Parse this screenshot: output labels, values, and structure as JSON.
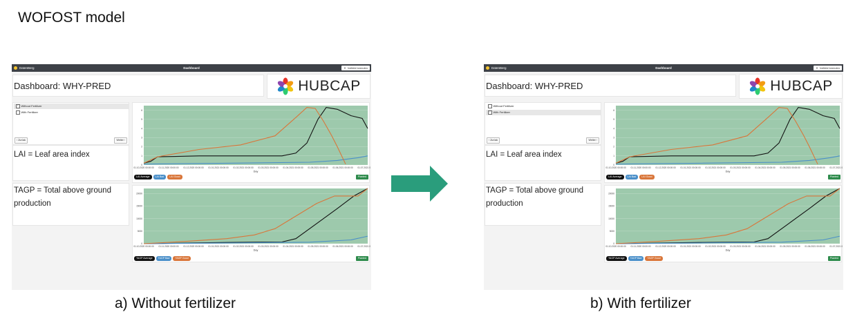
{
  "page": {
    "title": "WOFOST model",
    "arrow_color": "#2a9d7c"
  },
  "dashboard": {
    "brand": "DatenBerg",
    "bar_title": "Dashboard",
    "fullscreen_label": "Vollbild beenden",
    "title": "Dashboard: WHY-PRED",
    "logo_text": "HUBCAP",
    "logo_icon": "hubcap-petal-logo",
    "options": [
      "Without Fertilizer",
      "With Fertilizer"
    ],
    "back_label": "Zurück",
    "next_label": "Weiter",
    "lai_text": "LAI = Leaf area index",
    "tagp_text": "TAGP = Total above ground production",
    "planted_label": "Planted",
    "lai_legend": [
      "LAI Average",
      "LAI Bad",
      "LAI Good"
    ],
    "tagp_legend": [
      "TAGP Average",
      "TAGP Bad",
      "TAGP Good"
    ],
    "xlabel": "Day",
    "plot_bg": "#9dc9ac",
    "series_colors": {
      "average": "#111111",
      "bad": "#4a8fc9",
      "good": "#d9763a"
    }
  },
  "screens": [
    {
      "caption": "a) Without fertilizer",
      "selected_option": 0,
      "chart_data": [
        {
          "type": "line",
          "series": [
            {
              "name": "LAI Average",
              "points": [
                [
                  0,
                  0.2
                ],
                [
                  5,
                  0.4
                ],
                [
                  10,
                  0.9
                ],
                [
                  40,
                  1.0
                ],
                [
                  100,
                  1.0
                ],
                [
                  110,
                  1.3
                ],
                [
                  118,
                  2.4
                ],
                [
                  126,
                  5.0
                ],
                [
                  132,
                  6.3
                ],
                [
                  140,
                  6.1
                ],
                [
                  150,
                  5.4
                ],
                [
                  158,
                  5.1
                ],
                [
                  162,
                  4.0
                ]
              ]
            },
            {
              "name": "LAI Bad",
              "points": [
                [
                  0,
                  0.1
                ],
                [
                  60,
                  0.2
                ],
                [
                  120,
                  0.3
                ],
                [
                  140,
                  0.5
                ],
                [
                  155,
                  0.8
                ],
                [
                  162,
                  1.0
                ]
              ]
            },
            {
              "name": "LAI Good",
              "points": [
                [
                  0,
                  0.2
                ],
                [
                  10,
                  0.9
                ],
                [
                  40,
                  1.7
                ],
                [
                  70,
                  2.2
                ],
                [
                  95,
                  3.2
                ],
                [
                  110,
                  5.2
                ],
                [
                  118,
                  6.3
                ],
                [
                  124,
                  6.2
                ],
                [
                  130,
                  4.8
                ],
                [
                  136,
                  3.2
                ],
                [
                  140,
                  2.0
                ],
                [
                  146,
                  0.1
                ]
              ]
            }
          ],
          "ylim": [
            0,
            6.5
          ],
          "yticks": [
            0,
            1,
            2,
            3,
            4,
            5,
            6
          ],
          "xlim": [
            0,
            162
          ],
          "xticks": [
            "01.10.2020 00:00:00",
            "01.11.2020 00:00:00",
            "01.12.2020 00:00:00",
            "01.01.2021 00:00:00",
            "01.02.2021 00:00:00",
            "01.03.2021 00:00:00",
            "01.04.2021 00:00:00",
            "01.05.2021 00:00:00",
            "01.06.2021 00:00:00",
            "01.07.2021 00:00:00"
          ],
          "xlabel": "Day",
          "grid": true
        },
        {
          "type": "line",
          "series": [
            {
              "name": "TAGP Average",
              "points": [
                [
                  0,
                  0
                ],
                [
                  60,
                  500
                ],
                [
                  100,
                  700
                ],
                [
                  110,
                  2000
                ],
                [
                  125,
                  8000
                ],
                [
                  140,
                  14000
                ],
                [
                  152,
                  19000
                ],
                [
                  162,
                  22000
                ]
              ]
            },
            {
              "name": "TAGP Bad",
              "points": [
                [
                  0,
                  0
                ],
                [
                  60,
                  300
                ],
                [
                  120,
                  600
                ],
                [
                  150,
                  1500
                ],
                [
                  162,
                  3000
                ]
              ]
            },
            {
              "name": "TAGP Good",
              "points": [
                [
                  0,
                  0
                ],
                [
                  30,
                  900
                ],
                [
                  60,
                  2000
                ],
                [
                  80,
                  3500
                ],
                [
                  95,
                  6000
                ],
                [
                  110,
                  11000
                ],
                [
                  125,
                  16000
                ],
                [
                  138,
                  19000
                ],
                [
                  155,
                  19000
                ],
                [
                  162,
                  22000
                ]
              ]
            }
          ],
          "ylim": [
            0,
            22000
          ],
          "yticks": [
            0,
            5000,
            10000,
            15000,
            20000
          ],
          "xlim": [
            0,
            162
          ],
          "xticks": [
            "01.10.2020 00:00:00",
            "01.11.2020 00:00:00",
            "01.12.2020 00:00:00",
            "01.01.2021 00:00:00",
            "01.02.2021 00:00:00",
            "01.03.2021 00:00:00",
            "01.04.2021 00:00:00",
            "01.05.2021 00:00:00",
            "01.06.2021 00:00:00",
            "01.07.2021 00:00:00"
          ],
          "xlabel": "Day",
          "grid": true
        }
      ]
    },
    {
      "caption": "b) With fertilizer",
      "selected_option": 1,
      "chart_data": [
        {
          "type": "line",
          "series": [
            {
              "name": "LAI Average",
              "points": [
                [
                  0,
                  0.2
                ],
                [
                  5,
                  0.4
                ],
                [
                  10,
                  0.9
                ],
                [
                  40,
                  1.0
                ],
                [
                  100,
                  1.0
                ],
                [
                  110,
                  1.3
                ],
                [
                  118,
                  2.4
                ],
                [
                  126,
                  5.0
                ],
                [
                  132,
                  6.3
                ],
                [
                  140,
                  6.1
                ],
                [
                  150,
                  5.4
                ],
                [
                  158,
                  5.1
                ],
                [
                  162,
                  4.0
                ]
              ]
            },
            {
              "name": "LAI Bad",
              "points": [
                [
                  0,
                  0.1
                ],
                [
                  60,
                  0.2
                ],
                [
                  120,
                  0.3
                ],
                [
                  140,
                  0.5
                ],
                [
                  155,
                  0.8
                ],
                [
                  162,
                  1.0
                ]
              ]
            },
            {
              "name": "LAI Good",
              "points": [
                [
                  0,
                  0.2
                ],
                [
                  10,
                  0.9
                ],
                [
                  40,
                  1.7
                ],
                [
                  70,
                  2.2
                ],
                [
                  95,
                  3.2
                ],
                [
                  110,
                  5.2
                ],
                [
                  118,
                  6.3
                ],
                [
                  124,
                  6.2
                ],
                [
                  130,
                  4.8
                ],
                [
                  136,
                  3.2
                ],
                [
                  140,
                  2.0
                ],
                [
                  146,
                  0.1
                ]
              ]
            }
          ],
          "ylim": [
            0,
            6.5
          ],
          "yticks": [
            0,
            1,
            2,
            3,
            4,
            5,
            6
          ],
          "xlim": [
            0,
            162
          ],
          "xticks": [
            "01.10.2020 00:00:00",
            "01.11.2020 00:00:00",
            "01.12.2020 00:00:00",
            "01.01.2021 00:00:00",
            "01.02.2021 00:00:00",
            "01.03.2021 00:00:00",
            "01.04.2021 00:00:00",
            "01.05.2021 00:00:00",
            "01.06.2021 00:00:00",
            "01.07.2021 00:00:00"
          ],
          "xlabel": "Day",
          "grid": true
        },
        {
          "type": "line",
          "series": [
            {
              "name": "TAGP Average",
              "points": [
                [
                  0,
                  0
                ],
                [
                  60,
                  500
                ],
                [
                  100,
                  700
                ],
                [
                  110,
                  2000
                ],
                [
                  125,
                  8000
                ],
                [
                  140,
                  14000
                ],
                [
                  152,
                  19000
                ],
                [
                  162,
                  22000
                ]
              ]
            },
            {
              "name": "TAGP Bad",
              "points": [
                [
                  0,
                  0
                ],
                [
                  60,
                  300
                ],
                [
                  120,
                  600
                ],
                [
                  150,
                  1500
                ],
                [
                  162,
                  3000
                ]
              ]
            },
            {
              "name": "TAGP Good",
              "points": [
                [
                  0,
                  0
                ],
                [
                  30,
                  900
                ],
                [
                  60,
                  2000
                ],
                [
                  80,
                  3500
                ],
                [
                  95,
                  6000
                ],
                [
                  110,
                  11000
                ],
                [
                  125,
                  16000
                ],
                [
                  138,
                  19000
                ],
                [
                  155,
                  19000
                ],
                [
                  162,
                  22000
                ]
              ]
            }
          ],
          "ylim": [
            0,
            22000
          ],
          "yticks": [
            0,
            5000,
            10000,
            15000,
            20000
          ],
          "xlim": [
            0,
            162
          ],
          "xticks": [
            "01.10.2020 00:00:00",
            "01.11.2020 00:00:00",
            "01.12.2020 00:00:00",
            "01.01.2021 00:00:00",
            "01.02.2021 00:00:00",
            "01.03.2021 00:00:00",
            "01.04.2021 00:00:00",
            "01.05.2021 00:00:00",
            "01.06.2021 00:00:00",
            "01.07.2021 00:00:00"
          ],
          "xlabel": "Day",
          "grid": true
        }
      ]
    }
  ]
}
